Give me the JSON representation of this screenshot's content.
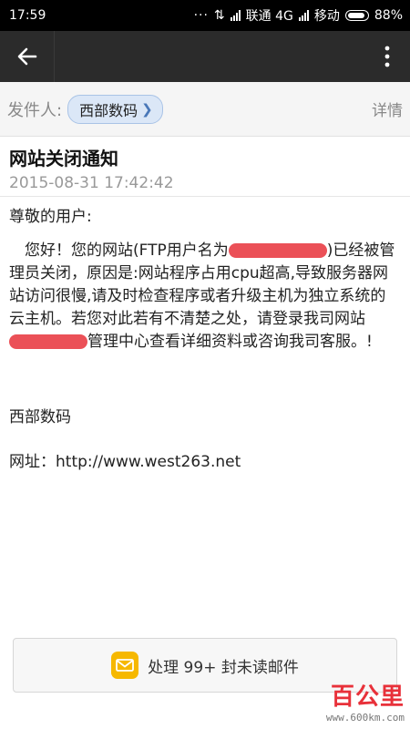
{
  "status_bar": {
    "time": "17:59",
    "carrier1": "联通 4G",
    "carrier2": "移动",
    "battery": "88%"
  },
  "toolbar": {
    "back_icon": "back-arrow-icon",
    "more_icon": "more-vertical-icon"
  },
  "sender": {
    "label": "发件人:",
    "name": "西部数码",
    "details": "详情"
  },
  "mail": {
    "subject": "网站关闭通知",
    "date": "2015-08-31 17:42:42",
    "greeting": "尊敬的用户:",
    "para_a": "　您好！您的网站(FTP用户名为",
    "para_b": ")已经被管理员关闭，原因是:网站程序占用cpu超高,导致服务器网站访问很慢,请及时检查程序或者升级主机为独立系统的云主机。若您对此若有不清楚之处，请登录我司网站",
    "para_c": "管理中心查看详细资料或咨询我司客服。!",
    "signature": "西部数码",
    "url_line": "网址：http://www.west263.net"
  },
  "action": {
    "label": "处理 99+ 封未读邮件",
    "icon": "mail-icon"
  },
  "watermark": {
    "brand": "百公里",
    "site": "www.600km.com"
  },
  "colors": {
    "toolbar_bg": "#2b2b2b",
    "chip_bg": "#dbe7f7",
    "redaction": "#e8313a",
    "mail_icon": "#f6b800"
  }
}
